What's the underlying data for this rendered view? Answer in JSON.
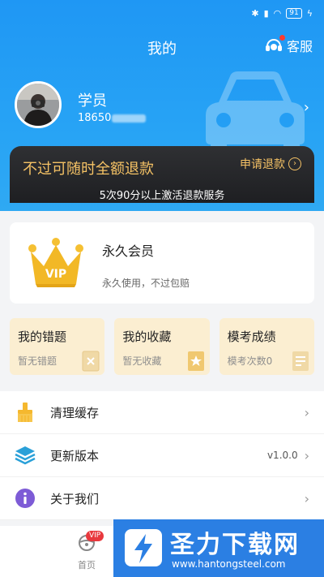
{
  "status_bar": {
    "battery": "91"
  },
  "header": {
    "title": "我的",
    "service_label": "客服"
  },
  "user": {
    "name": "学员",
    "phone_prefix": "18650"
  },
  "refund": {
    "title": "不过可随时全额退款",
    "action": "申请退款",
    "subtitle": "5次90分以上激活退款服务"
  },
  "vip": {
    "title": "永久会员",
    "desc": "永久使用，不过包赔",
    "crown_text": "VIP"
  },
  "tiles": [
    {
      "title": "我的错题",
      "sub": "暂无错题"
    },
    {
      "title": "我的收藏",
      "sub": "暂无收藏"
    },
    {
      "title": "模考成绩",
      "sub": "模考次数0"
    }
  ],
  "menu": [
    {
      "label": "清理缓存",
      "value": ""
    },
    {
      "label": "更新版本",
      "value": "v1.0.0"
    },
    {
      "label": "关于我们",
      "value": ""
    }
  ],
  "tabbar": {
    "home_label": "首页",
    "vip_badge": "VIP"
  },
  "watermark": {
    "title": "圣力下载网",
    "url": "www.hantongsteel.com"
  },
  "colors": {
    "primary": "#1f97f4",
    "gold": "#f5c265",
    "tile_bg": "#fbeed1",
    "badge": "#e8383d"
  }
}
